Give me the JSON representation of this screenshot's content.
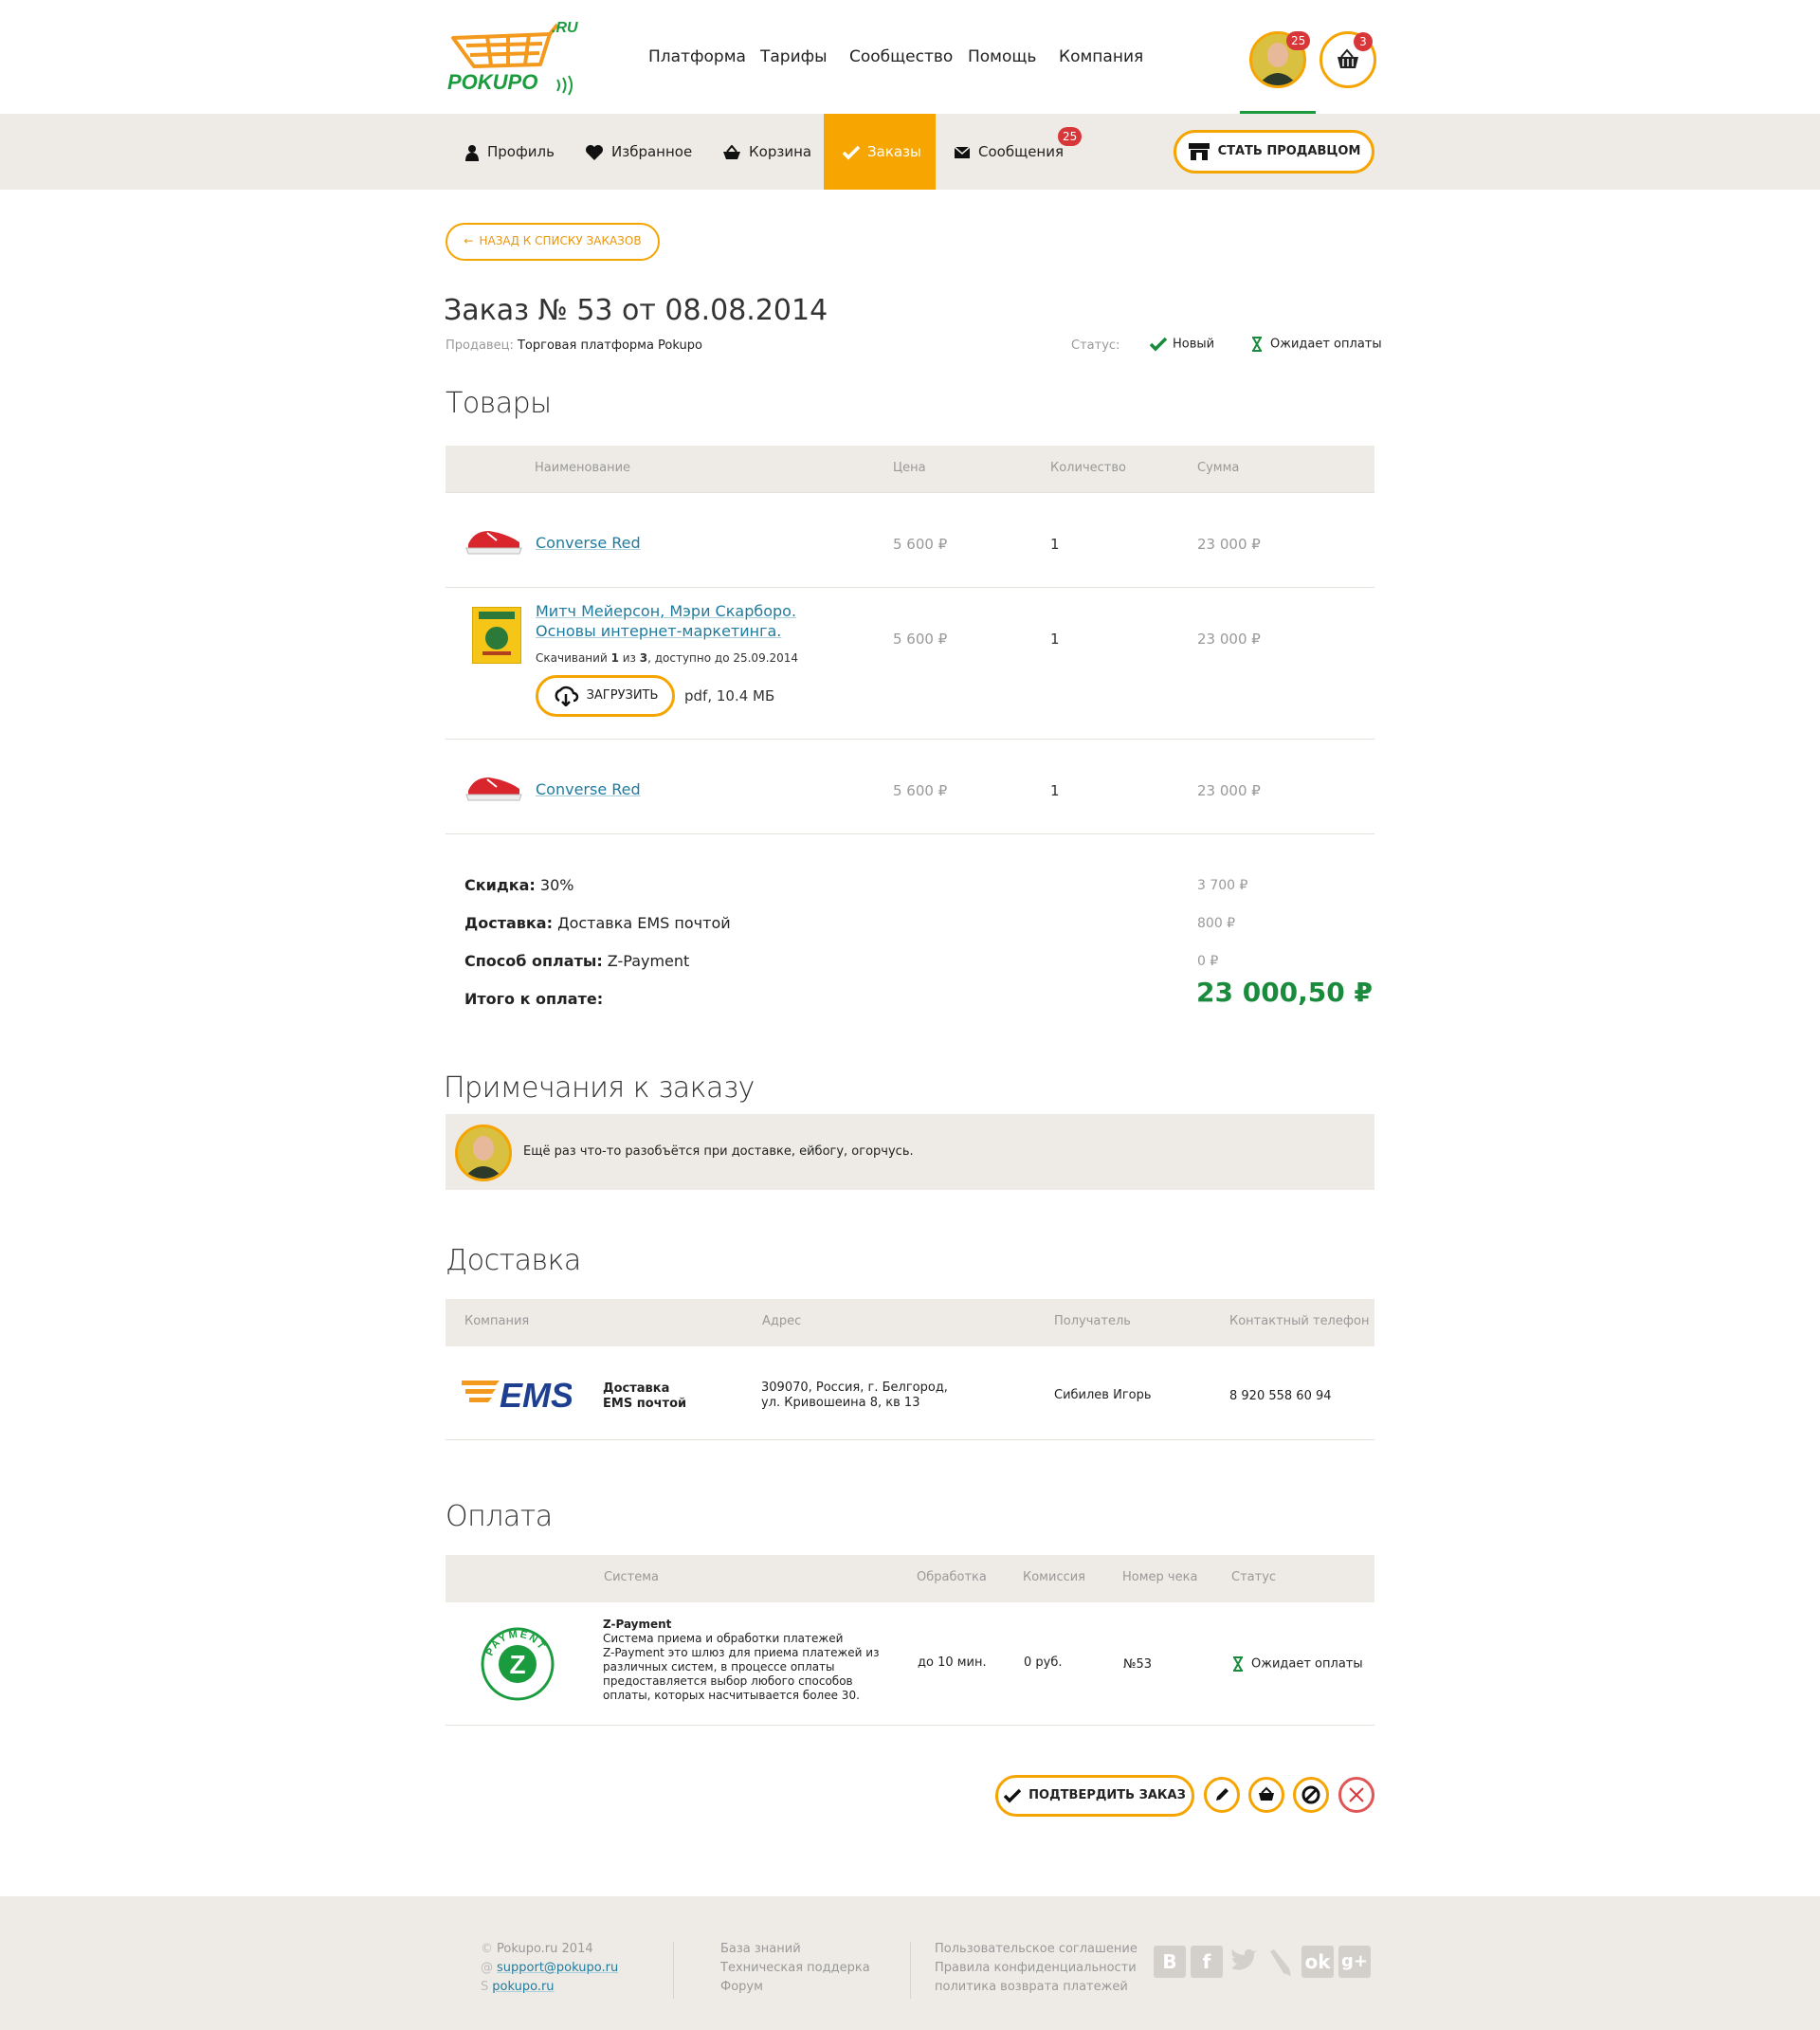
{
  "header": {
    "logo_text": "POKUPO",
    "logo_suffix": ".RU",
    "nav": [
      "Платформа",
      "Тарифы",
      "Сообщество",
      "Помощь",
      "Компания"
    ],
    "avatar_badge": "25",
    "cart_badge": "3"
  },
  "subnav": {
    "items": [
      {
        "label": "Профиль",
        "icon": "user-icon"
      },
      {
        "label": "Избранное",
        "icon": "heart-icon"
      },
      {
        "label": "Корзина",
        "icon": "basket-icon"
      },
      {
        "label": "Заказы",
        "icon": "check-icon",
        "active": true
      },
      {
        "label": "Сообщения",
        "icon": "envelope-icon",
        "badge": "25"
      }
    ],
    "seller_button": "СТАТЬ ПРОДАВЦОМ"
  },
  "back_button": "НАЗАД К СПИСКУ ЗАКАЗОВ",
  "order": {
    "title": "Заказ № 53 от 08.08.2014",
    "seller_label": "Продавец:",
    "seller_name": "Торговая платформа Pokupo",
    "status_label": "Статус:",
    "status_new": "Новый",
    "status_wait": "Ожидает оплаты"
  },
  "goods": {
    "title": "Товары",
    "headers": [
      "Наименование",
      "Цена",
      "Количество",
      "Сумма"
    ],
    "rows": [
      {
        "name": "Converse Red",
        "price": "5 600 ₽",
        "qty": "1",
        "sum": "23 000 ₽"
      },
      {
        "name_line1": "Митч Мейерсон, Мэри Скарборо.",
        "name_line2": "Основы интернет-маркетинга.",
        "downloads_prefix": "Скачиваний ",
        "downloads_done": "1",
        "downloads_mid": " из ",
        "downloads_total": "3",
        "downloads_suffix": ",  доступно до 25.09.2014",
        "download_button": "ЗАГРУЗИТЬ",
        "file_info": "pdf, 10.4 МБ",
        "price": "5 600 ₽",
        "qty": "1",
        "sum": "23 000 ₽"
      },
      {
        "name": "Converse Red",
        "price": "5 600 ₽",
        "qty": "1",
        "sum": "23 000 ₽"
      }
    ]
  },
  "totals": {
    "discount_label": "Скидка:",
    "discount_value": " 30%",
    "discount_amount": "3 700 ₽",
    "delivery_label": "Доставка:",
    "delivery_value": " Доставка EMS почтой",
    "delivery_amount": "800 ₽",
    "payment_label": "Способ оплаты:",
    "payment_value": " Z-Payment",
    "payment_amount": "0 ₽",
    "total_label": "Итого к оплате:",
    "total_amount": "23 000,50 ₽",
    "total_color": "#1a8a3c"
  },
  "notes": {
    "title": "Примечания к заказу",
    "text": "Ещё раз что-то разобъётся при доставке, ейбогу, огорчусь."
  },
  "delivery": {
    "title": "Доставка",
    "headers": [
      "Компания",
      "Адрес",
      "Получатель",
      "Контактный телефон"
    ],
    "logo_text": "EMS",
    "company_line1": "Доставка",
    "company_line2": "EMS почтой",
    "address_line1": "309070, Россия, г. Белгород,",
    "address_line2": "ул. Кривошеина 8, кв 13",
    "recipient": "Сибилев Игорь",
    "phone": "8 920 558 60 94"
  },
  "payment": {
    "title": "Оплата",
    "headers": [
      "Система",
      "Обработка",
      "Комиссия",
      "Номер чека",
      "Статус"
    ],
    "logo_letter": "Z",
    "logo_ring_text": "PAYMENT",
    "system_name": "Z-Payment",
    "desc_lines": [
      "Система приема и обработки платежей",
      "Z-Payment это шлюз для приема платежей из",
      "различных систем, в процессе оплаты",
      "предоставляется выбор любого способов",
      "оплаты, которых насчитывается более 30."
    ],
    "processing": "до 10 мин.",
    "fee": "0 руб.",
    "receipt": "№53",
    "status": "Ожидает оплаты"
  },
  "actions": {
    "confirm": "ПОДТВЕРДИТЬ ЗАКАЗ"
  },
  "footer": {
    "col1": [
      "Pokupo.ru 2014",
      "support@pokupo.ru",
      "pokupo.ru"
    ],
    "col2": [
      "База знаний",
      "Техническая поддерка",
      "Форум"
    ],
    "col3": [
      "Пользовательское соглашение",
      "Правила конфиденциальности",
      "политика возврата платежей"
    ],
    "social": [
      "vk-icon",
      "facebook-icon",
      "twitter-icon",
      "livejournal-icon",
      "odnoklassniki-icon",
      "googleplus-icon"
    ]
  },
  "colors": {
    "accent": "#f5a400",
    "green": "#1a9c3e",
    "badge": "#d8373a",
    "link": "#1f7b9e",
    "panel": "#eeebe6"
  }
}
